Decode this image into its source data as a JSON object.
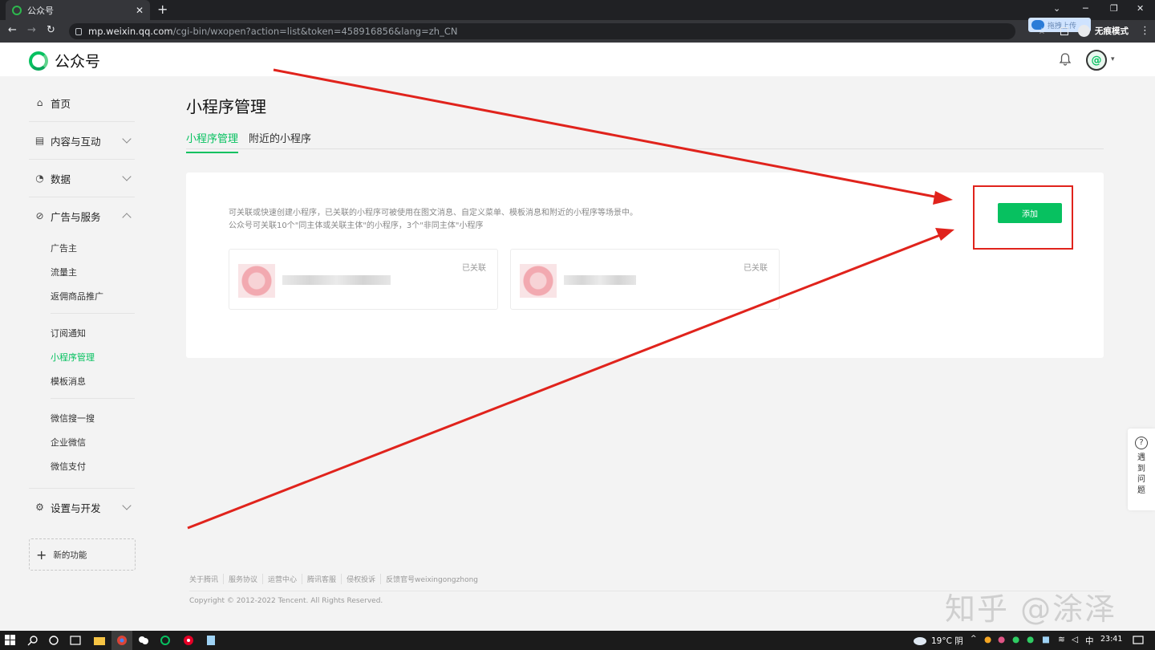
{
  "browser": {
    "tab_title": "公众号",
    "tab_close": "✕",
    "new_tab": "+",
    "url_host": "mp.weixin.qq.com",
    "url_path": "/cgi-bin/wxopen?action=list&token=458916856&lang=zh_CN",
    "extension_label": "拖拽上传",
    "incognito_label": "无痕模式"
  },
  "header": {
    "brand": "公众号",
    "brand_color": "#07c160"
  },
  "sidebar": {
    "home": "首页",
    "content": "内容与互动",
    "data": "数据",
    "ads": "广告与服务",
    "ad_items": [
      "广告主",
      "流量主",
      "返佣商品推广"
    ],
    "feature_items": [
      "订阅通知",
      "小程序管理",
      "模板消息"
    ],
    "other_items": [
      "微信搜一搜",
      "企业微信",
      "微信支付"
    ],
    "settings": "设置与开发",
    "new_features": "新的功能"
  },
  "main": {
    "title": "小程序管理",
    "tabs": [
      "小程序管理",
      "附近的小程序"
    ],
    "desc_line1": "可关联或快速创建小程序，已关联的小程序可被使用在图文消息、自定义菜单、模板消息和附近的小程序等场景中。",
    "desc_line2": "公众号可关联10个\"同主体或关联主体\"的小程序，3个\"非同主体\"小程序",
    "cards": [
      {
        "status": "已关联"
      },
      {
        "status": "已关联"
      }
    ],
    "add_button": "添加",
    "accent_color": "#07c160",
    "highlight_color": "#e0231c"
  },
  "footer": {
    "links": [
      "关于腾讯",
      "服务协议",
      "运营中心",
      "腾讯客服",
      "侵权投诉",
      "反馈官号weixingongzhong"
    ],
    "copyright": "Copyright © 2012-2022 Tencent. All Rights Reserved."
  },
  "help_widget": {
    "chars": [
      "遇",
      "到",
      "问",
      "题"
    ]
  },
  "watermark": "知乎 @涂泽",
  "taskbar": {
    "weather": "19°C 阴",
    "ime": "中",
    "time": "23:41"
  }
}
